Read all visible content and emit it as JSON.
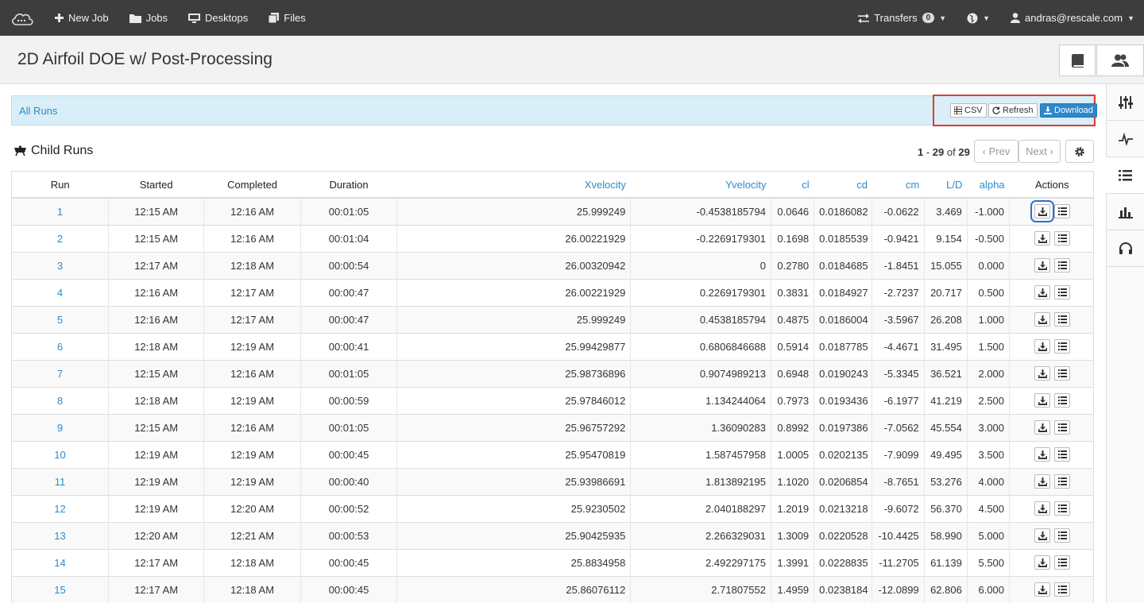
{
  "nav": {
    "new_job": "New Job",
    "jobs": "Jobs",
    "desktops": "Desktops",
    "files": "Files",
    "transfers": "Transfers",
    "transfers_count": "0",
    "user": "andras@rescale.com"
  },
  "page": {
    "title": "2D Airfoil DOE w/ Post-Processing"
  },
  "runs_bar": {
    "crumb": "All Runs",
    "csv": "CSV",
    "refresh": "Refresh",
    "download": "Download"
  },
  "section": {
    "title": "Child Runs",
    "range_start": "1",
    "range_sep": " - ",
    "range_end": "29",
    "of": " of ",
    "total": "29",
    "prev": "‹ Prev",
    "next": "Next ›"
  },
  "table": {
    "headers": [
      "Run",
      "Started",
      "Completed",
      "Duration",
      "Xvelocity",
      "Yvelocity",
      "cl",
      "cd",
      "cm",
      "L/D",
      "alpha",
      "Actions"
    ],
    "rows": [
      [
        "1",
        "12:15 AM",
        "12:16 AM",
        "00:01:05",
        "25.999249",
        "-0.4538185794",
        "0.0646",
        "0.0186082",
        "-0.0622",
        "3.469",
        "-1.000"
      ],
      [
        "2",
        "12:15 AM",
        "12:16 AM",
        "00:01:04",
        "26.00221929",
        "-0.2269179301",
        "0.1698",
        "0.0185539",
        "-0.9421",
        "9.154",
        "-0.500"
      ],
      [
        "3",
        "12:17 AM",
        "12:18 AM",
        "00:00:54",
        "26.00320942",
        "0",
        "0.2780",
        "0.0184685",
        "-1.8451",
        "15.055",
        "0.000"
      ],
      [
        "4",
        "12:16 AM",
        "12:17 AM",
        "00:00:47",
        "26.00221929",
        "0.2269179301",
        "0.3831",
        "0.0184927",
        "-2.7237",
        "20.717",
        "0.500"
      ],
      [
        "5",
        "12:16 AM",
        "12:17 AM",
        "00:00:47",
        "25.999249",
        "0.4538185794",
        "0.4875",
        "0.0186004",
        "-3.5967",
        "26.208",
        "1.000"
      ],
      [
        "6",
        "12:18 AM",
        "12:19 AM",
        "00:00:41",
        "25.99429877",
        "0.6806846688",
        "0.5914",
        "0.0187785",
        "-4.4671",
        "31.495",
        "1.500"
      ],
      [
        "7",
        "12:15 AM",
        "12:16 AM",
        "00:01:05",
        "25.98736896",
        "0.9074989213",
        "0.6948",
        "0.0190243",
        "-5.3345",
        "36.521",
        "2.000"
      ],
      [
        "8",
        "12:18 AM",
        "12:19 AM",
        "00:00:59",
        "25.97846012",
        "1.134244064",
        "0.7973",
        "0.0193436",
        "-6.1977",
        "41.219",
        "2.500"
      ],
      [
        "9",
        "12:15 AM",
        "12:16 AM",
        "00:01:05",
        "25.96757292",
        "1.36090283",
        "0.8992",
        "0.0197386",
        "-7.0562",
        "45.554",
        "3.000"
      ],
      [
        "10",
        "12:19 AM",
        "12:19 AM",
        "00:00:45",
        "25.95470819",
        "1.587457958",
        "1.0005",
        "0.0202135",
        "-7.9099",
        "49.495",
        "3.500"
      ],
      [
        "11",
        "12:19 AM",
        "12:19 AM",
        "00:00:40",
        "25.93986691",
        "1.813892195",
        "1.1020",
        "0.0206854",
        "-8.7651",
        "53.276",
        "4.000"
      ],
      [
        "12",
        "12:19 AM",
        "12:20 AM",
        "00:00:52",
        "25.9230502",
        "2.040188297",
        "1.2019",
        "0.0213218",
        "-9.6072",
        "56.370",
        "4.500"
      ],
      [
        "13",
        "12:20 AM",
        "12:21 AM",
        "00:00:53",
        "25.90425935",
        "2.266329031",
        "1.3009",
        "0.0220528",
        "-10.4425",
        "58.990",
        "5.000"
      ],
      [
        "14",
        "12:17 AM",
        "12:18 AM",
        "00:00:45",
        "25.8834958",
        "2.492297175",
        "1.3991",
        "0.0228835",
        "-11.2705",
        "61.139",
        "5.500"
      ],
      [
        "15",
        "12:17 AM",
        "12:18 AM",
        "00:00:45",
        "25.86076112",
        "2.71807552",
        "1.4959",
        "0.0238184",
        "-12.0899",
        "62.806",
        "6.000"
      ]
    ]
  }
}
